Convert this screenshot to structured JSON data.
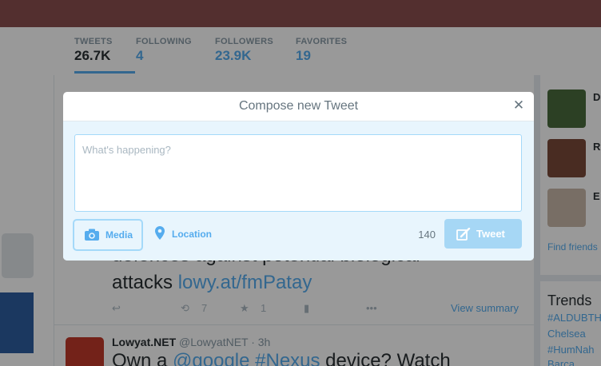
{
  "profile_nav": {
    "stats": [
      {
        "label": "TWEETS",
        "value": "26.7K"
      },
      {
        "label": "FOLLOWING",
        "value": "4"
      },
      {
        "label": "FOLLOWERS",
        "value": "23.9K"
      },
      {
        "label": "FAVORITES",
        "value": "19"
      }
    ]
  },
  "timeline": {
    "tweet1_line1": "defences against potential biological",
    "tweet1_line2_text": "attacks ",
    "tweet1_link": "lowy.at/fmPatay",
    "retweets": "7",
    "favorites": "1",
    "view_summary": "View summary",
    "tweet2_name": "Lowyat.NET",
    "tweet2_handle": "@LowyatNET · 3h",
    "tweet2_text_a": "Own a ",
    "tweet2_mention": "@google",
    "tweet2_hashtag": "#Nexus",
    "tweet2_text_b": " device? Watch"
  },
  "sidebar": {
    "who_to_follow": [
      {
        "initial": "D"
      },
      {
        "initial": "R"
      },
      {
        "initial": "E"
      }
    ],
    "find_friends": "Find friends",
    "trends_title": "Trends",
    "trends": [
      "#ALDUBTH",
      "Chelsea",
      "#HumNah",
      "Barca"
    ]
  },
  "modal": {
    "title": "Compose new Tweet",
    "close_icon": "close-icon",
    "placeholder": "What's happening?",
    "media_label": "Media",
    "location_label": "Location",
    "char_count": "140",
    "tweet_label": "Tweet"
  },
  "colors": {
    "accent": "#55acee",
    "modal_body": "#e8f5fd",
    "tweet_button_disabled": "#a6d7f5",
    "banner": "#8b4f4f"
  }
}
